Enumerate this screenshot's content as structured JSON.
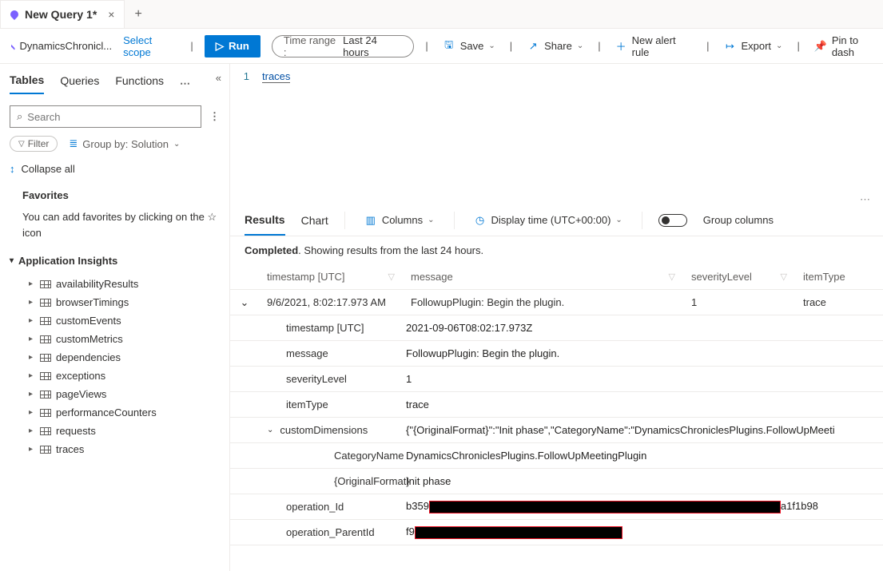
{
  "tabs": {
    "main": "New Query 1*"
  },
  "scope": {
    "name": "DynamicsChronicl...",
    "select": "Select scope"
  },
  "toolbar": {
    "run": "Run",
    "time_label": "Time range :",
    "time_value": "Last 24 hours",
    "save": "Save",
    "share": "Share",
    "alert": "New alert rule",
    "export": "Export",
    "pin": "Pin to dash"
  },
  "left": {
    "tabs": {
      "tables": "Tables",
      "queries": "Queries",
      "functions": "Functions"
    },
    "search_ph": "Search",
    "filter": "Filter",
    "groupby": "Group by: Solution",
    "collapse": "Collapse all",
    "fav_head": "Favorites",
    "fav_text": "You can add favorites by clicking on the ☆ icon",
    "appinsights": "Application Insights",
    "items": [
      "availabilityResults",
      "browserTimings",
      "customEvents",
      "customMetrics",
      "dependencies",
      "exceptions",
      "pageViews",
      "performanceCounters",
      "requests",
      "traces"
    ]
  },
  "editor": {
    "line1": "traces"
  },
  "results": {
    "tabs": {
      "results": "Results",
      "chart": "Chart",
      "columns": "Columns",
      "display_time": "Display time (UTC+00:00)",
      "group": "Group columns"
    },
    "status_b": "Completed",
    "status_rest": ". Showing results from the last 24 hours.",
    "headers": {
      "ts": "timestamp [UTC]",
      "msg": "message",
      "sev": "severityLevel",
      "it": "itemType"
    },
    "row": {
      "ts": "9/6/2021, 8:02:17.973 AM",
      "msg": "FollowupPlugin: Begin the plugin.",
      "sev": "1",
      "it": "trace"
    },
    "detail": {
      "timestamp_k": "timestamp [UTC]",
      "timestamp_v": "2021-09-06T08:02:17.973Z",
      "message_k": "message",
      "message_v": "FollowupPlugin: Begin the plugin.",
      "sev_k": "severityLevel",
      "sev_v": "1",
      "it_k": "itemType",
      "it_v": "trace",
      "cd_k": "customDimensions",
      "cd_v": "{\"{OriginalFormat}\":\"Init phase\",\"CategoryName\":\"DynamicsChroniclesPlugins.FollowUpMeeti",
      "cat_k": "CategoryName",
      "cat_v": "DynamicsChroniclesPlugins.FollowUpMeetingPlugin",
      "of_k": "{OriginalFormat}",
      "of_v": "Init phase",
      "op_k": "operation_Id",
      "op_pre": "b359",
      "op_post": "a1f1b98",
      "opp_k": "operation_ParentId",
      "opp_pre": "f9"
    }
  }
}
